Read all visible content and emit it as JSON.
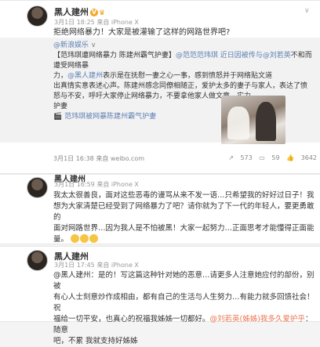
{
  "post1": {
    "name": "黑人建州",
    "vip": "V",
    "time": "3月1日 18:25 来自 iPhone X",
    "text": "拒绝网络暴力！大家是被灌输了这样的网路世界吧?",
    "repost": {
      "author": "@新浪娱乐",
      "line1": "【范玮琪遭网络暴力 陈建州霸气护妻】",
      "line1b": "@范范范玮琪 近日因被传与",
      "line1c": "@刘若英",
      "line1d": "不和而遭受网络暴",
      "line2": "力，",
      "line2b": "@黑人建州",
      "line2c": "表示是在抚慰一妻之心一事，感到愤怒并于网络贴文道",
      "line3": "出真情实意表述心声。陈建州感念同僚相随正，爱护太多的妻子与家人，表达了愤",
      "line4": "怒与不安，呼吁大家停止网络暴力，不要拿他家人做文章。实力",
      "line5": "护妻",
      "video": "🎬 范玮琪被网暴陈建州霸气护妻",
      "time": "3月1日 16:38 来自 weibo.com",
      "share": "573",
      "comments": "59",
      "likes": "3642"
    }
  },
  "post2": {
    "name": "黑人建州",
    "time": "3月1日 16:59 来自 iPhone X",
    "line1": "我太太很善良，面对这些恶毒的谩骂从来不发一语…只希望我的好好过日子！我",
    "line2": "想为大家清楚已经受到了网络暴力了吧？请你就为了下一代的年轻人，要更勇敢的",
    "line3": "面对网路世界…因为我人是不怕被黑！大家一起努力…正面思考才能懂得正面能",
    "line4": "量。"
  },
  "post3": {
    "name": "黑人建州",
    "time": "3月1日 17:45 来自 iPhone X",
    "line1": "@黑人建州：是的！写这篇这种针对她的恶意…请更多人注意她应付的部份，别被",
    "line2": "有心人士刻意炒作成相由，都有自己的生活与人生努力…有能力就多回馈社会！祝",
    "line3": "福给一切平安，也真心的祝福我姊姊一切都好。",
    "line3b": "@刘若英(姊姊)我多久爱护乎",
    "line3c": "：随意",
    "line4": "吧，不累 我就支持好姊姊"
  }
}
